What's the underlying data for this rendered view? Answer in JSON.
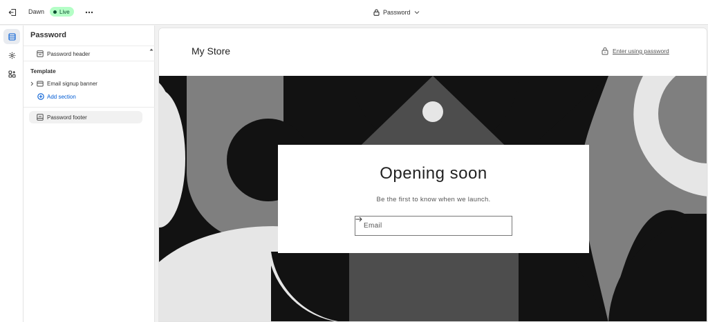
{
  "topbar": {
    "theme_name": "Dawn",
    "live_label": "Live",
    "page_selector": "Password"
  },
  "sidebar": {
    "title": "Password",
    "header_section": "Password header",
    "template_label": "Template",
    "template_items": [
      "Email signup banner"
    ],
    "add_section_label": "Add section",
    "footer_section": "Password footer"
  },
  "preview": {
    "store_name": "My Store",
    "enter_password_label": "Enter using password",
    "signup": {
      "title": "Opening soon",
      "subtitle": "Be the first to know when we launch.",
      "email_placeholder": "Email"
    }
  },
  "colors": {
    "accent": "#005bd3",
    "live_badge_bg": "#b4fec6",
    "live_badge_text": "#0c5132"
  }
}
